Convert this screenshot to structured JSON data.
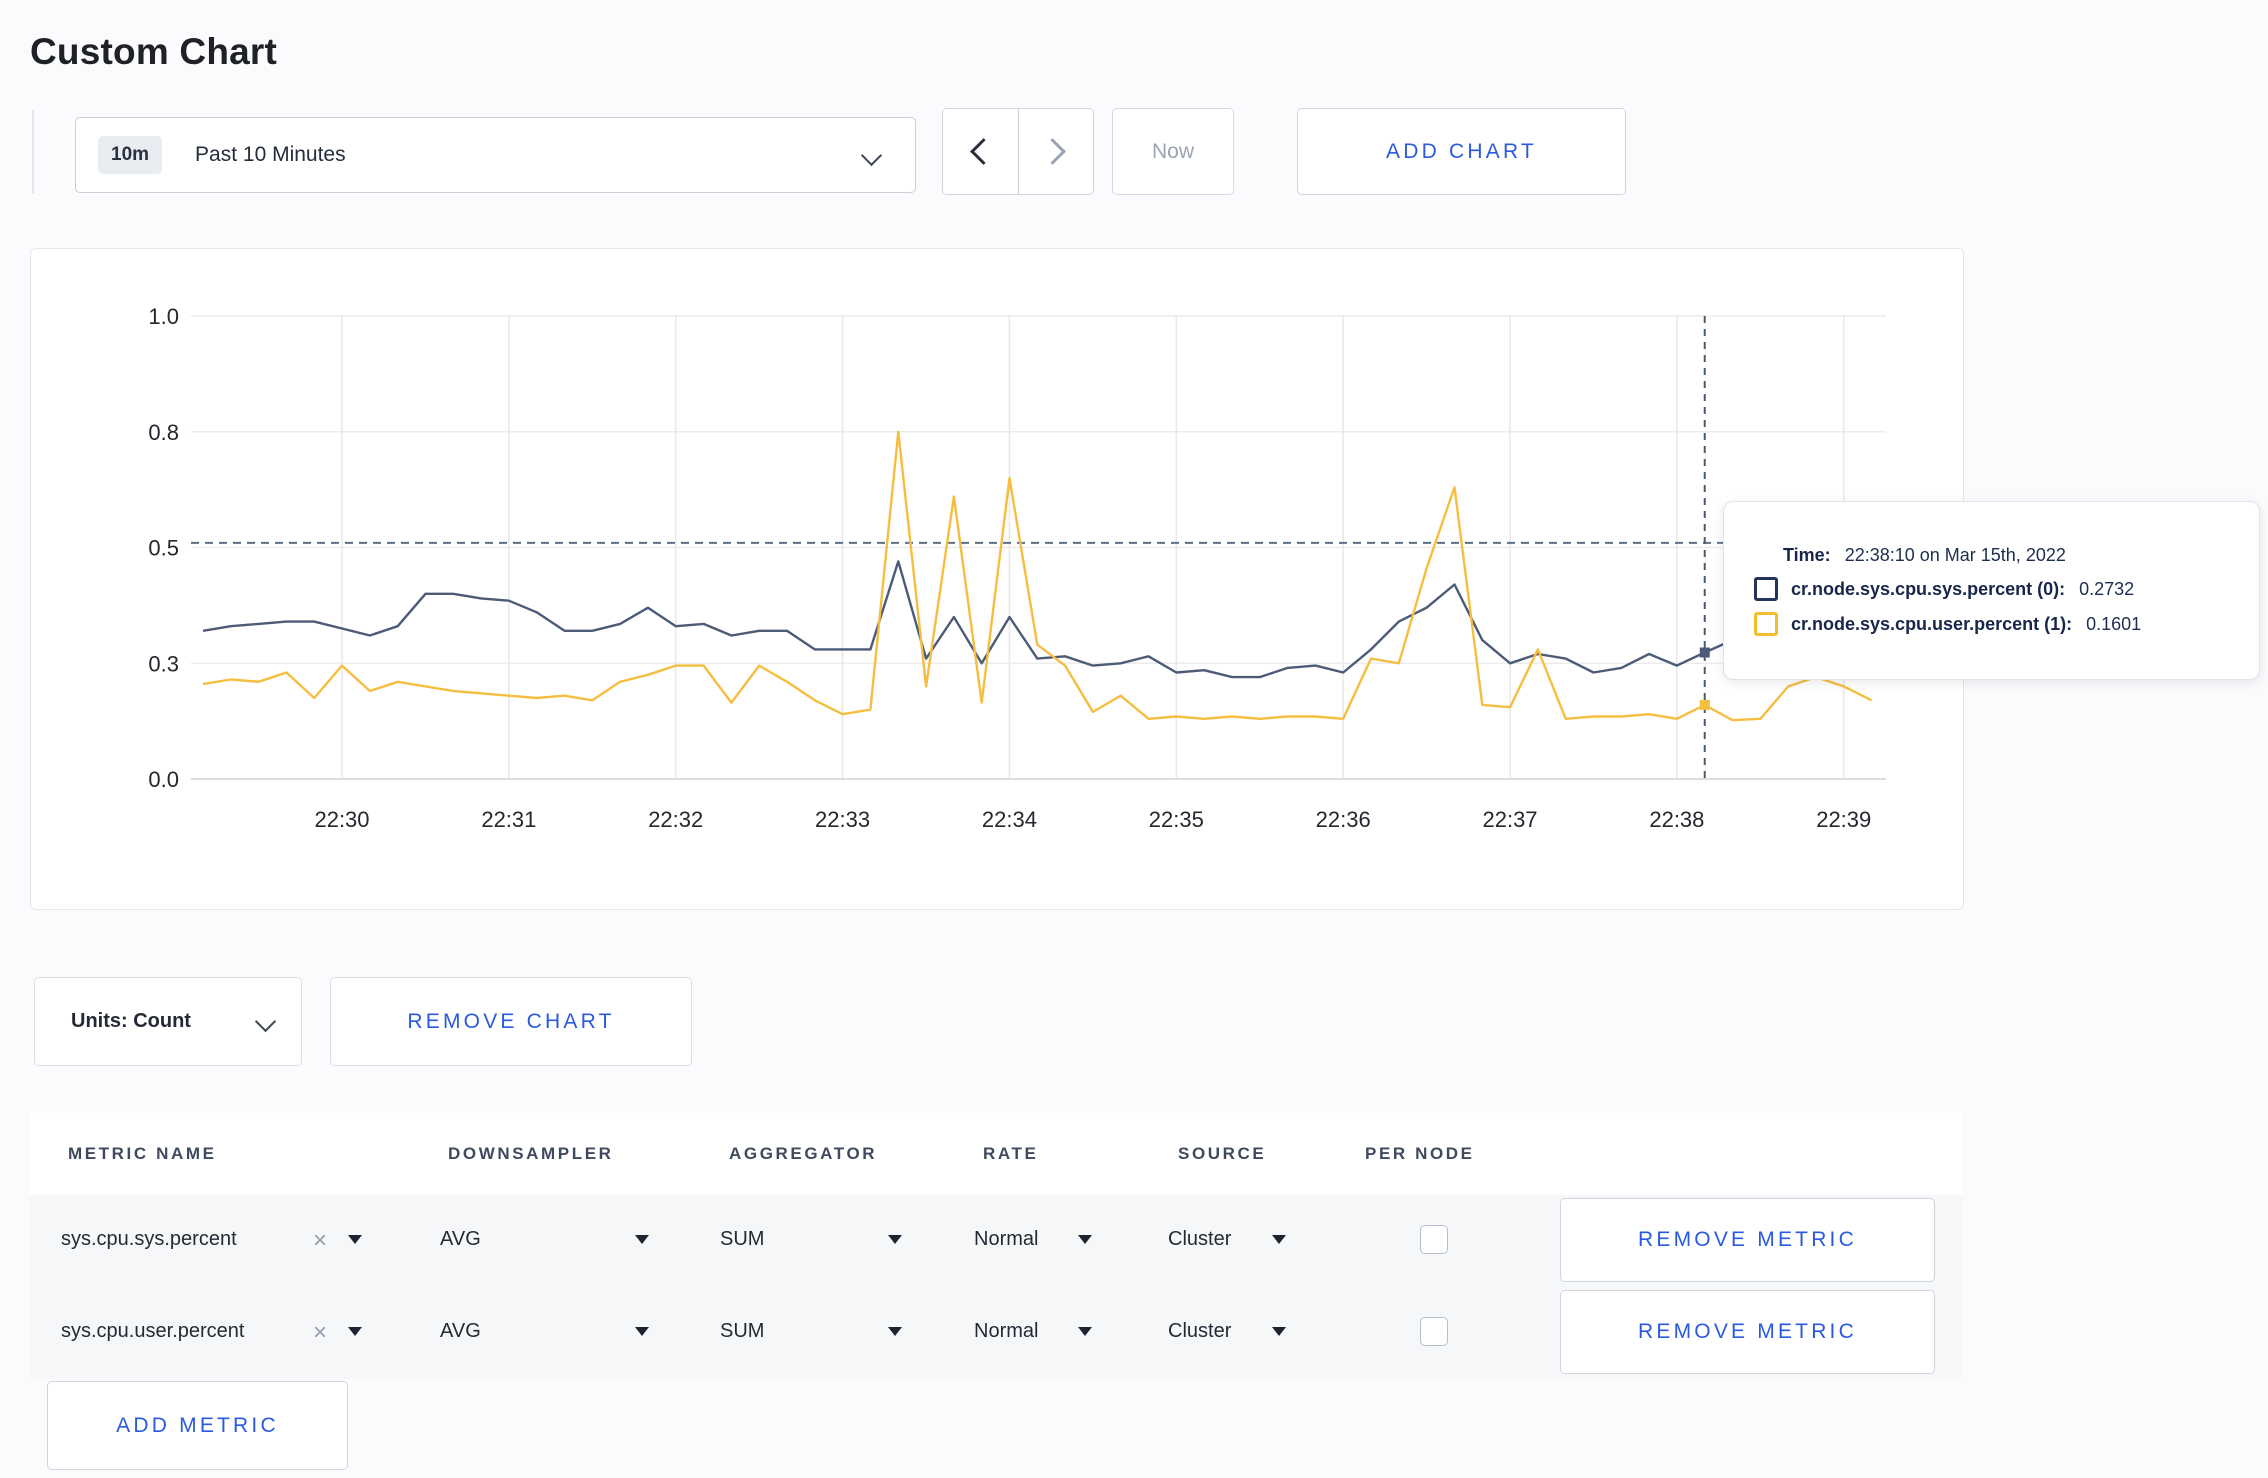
{
  "page": {
    "title": "Custom Chart"
  },
  "toolbar": {
    "range_badge": "10m",
    "range_label": "Past 10 Minutes",
    "prev_icon": "chevron-left",
    "next_icon": "chevron-right",
    "now_label": "Now",
    "add_chart_label": "ADD CHART"
  },
  "chart_data": {
    "type": "line",
    "title": "",
    "xlabel": "",
    "ylabel": "",
    "ylim": [
      0,
      1
    ],
    "grid": true,
    "x_start_time": "22:29:10",
    "x_step_seconds": 10,
    "x_tick_labels": [
      "22:30",
      "22:31",
      "22:32",
      "22:33",
      "22:34",
      "22:35",
      "22:36",
      "22:37",
      "22:38",
      "22:39"
    ],
    "y_ticks": [
      {
        "value": 0.0,
        "label": "0.0"
      },
      {
        "value": 0.25,
        "label": "0.3"
      },
      {
        "value": 0.5,
        "label": "0.5"
      },
      {
        "value": 0.75,
        "label": "0.8"
      },
      {
        "value": 1.0,
        "label": "1.0"
      }
    ],
    "series": [
      {
        "name": "cr.node.sys.cpu.sys.percent",
        "color": "#4c5b77",
        "values": [
          0.32,
          0.33,
          0.335,
          0.34,
          0.34,
          0.325,
          0.31,
          0.33,
          0.4,
          0.4,
          0.39,
          0.385,
          0.36,
          0.32,
          0.32,
          0.335,
          0.37,
          0.33,
          0.335,
          0.31,
          0.32,
          0.32,
          0.28,
          0.28,
          0.28,
          0.47,
          0.26,
          0.35,
          0.25,
          0.35,
          0.26,
          0.265,
          0.245,
          0.25,
          0.265,
          0.23,
          0.235,
          0.22,
          0.22,
          0.24,
          0.245,
          0.23,
          0.28,
          0.34,
          0.37,
          0.42,
          0.3,
          0.25,
          0.27,
          0.26,
          0.23,
          0.24,
          0.27,
          0.245,
          0.2732,
          0.3,
          0.305,
          0.3,
          0.295,
          0.3,
          0.3
        ]
      },
      {
        "name": "cr.node.sys.cpu.user.percent",
        "color": "#f6be40",
        "values": [
          0.205,
          0.215,
          0.21,
          0.23,
          0.175,
          0.245,
          0.19,
          0.21,
          0.2,
          0.19,
          0.185,
          0.18,
          0.175,
          0.18,
          0.17,
          0.21,
          0.225,
          0.245,
          0.245,
          0.165,
          0.245,
          0.21,
          0.17,
          0.14,
          0.15,
          0.75,
          0.2,
          0.61,
          0.165,
          0.65,
          0.29,
          0.245,
          0.145,
          0.18,
          0.13,
          0.135,
          0.13,
          0.135,
          0.13,
          0.135,
          0.135,
          0.13,
          0.26,
          0.25,
          0.455,
          0.63,
          0.16,
          0.155,
          0.28,
          0.13,
          0.135,
          0.135,
          0.14,
          0.13,
          0.1601,
          0.127,
          0.13,
          0.2,
          0.22,
          0.2,
          0.17
        ]
      }
    ],
    "legend_position": "tooltip",
    "crosshair": {
      "x_index": 54,
      "y_value": 0.51
    },
    "hover_points": [
      {
        "series": 0,
        "x_index": 54,
        "value": 0.2732
      },
      {
        "series": 1,
        "x_index": 54,
        "value": 0.1601
      }
    ]
  },
  "tooltip": {
    "time_label": "Time:",
    "time_value": "22:38:10 on Mar 15th, 2022",
    "rows": [
      {
        "label": "cr.node.sys.cpu.sys.percent (0):",
        "value": "0.2732",
        "swatch_color": "#24345a"
      },
      {
        "label": "cr.node.sys.cpu.user.percent (1):",
        "value": "0.1601",
        "swatch_color": "#f5bd2e"
      }
    ]
  },
  "chart_footer": {
    "units_label": "Units: Count",
    "remove_chart_label": "REMOVE CHART"
  },
  "metrics_table": {
    "headers": [
      "METRIC NAME",
      "DOWNSAMPLER",
      "AGGREGATOR",
      "RATE",
      "SOURCE",
      "PER NODE"
    ],
    "rows": [
      {
        "metric": "sys.cpu.sys.percent",
        "downsampler": "AVG",
        "aggregator": "SUM",
        "rate": "Normal",
        "source": "Cluster",
        "per_node_checked": false,
        "remove_label": "REMOVE METRIC"
      },
      {
        "metric": "sys.cpu.user.percent",
        "downsampler": "AVG",
        "aggregator": "SUM",
        "rate": "Normal",
        "source": "Cluster",
        "per_node_checked": false,
        "remove_label": "REMOVE METRIC"
      }
    ],
    "add_metric_label": "ADD METRIC"
  },
  "colors": {
    "accent_blue": "#2a5adf",
    "series_sys": "#4c5b77",
    "series_user": "#f6be40",
    "grid": "#ececee",
    "crosshair": "#5d7186",
    "row_bg": "#f6f7f9"
  }
}
